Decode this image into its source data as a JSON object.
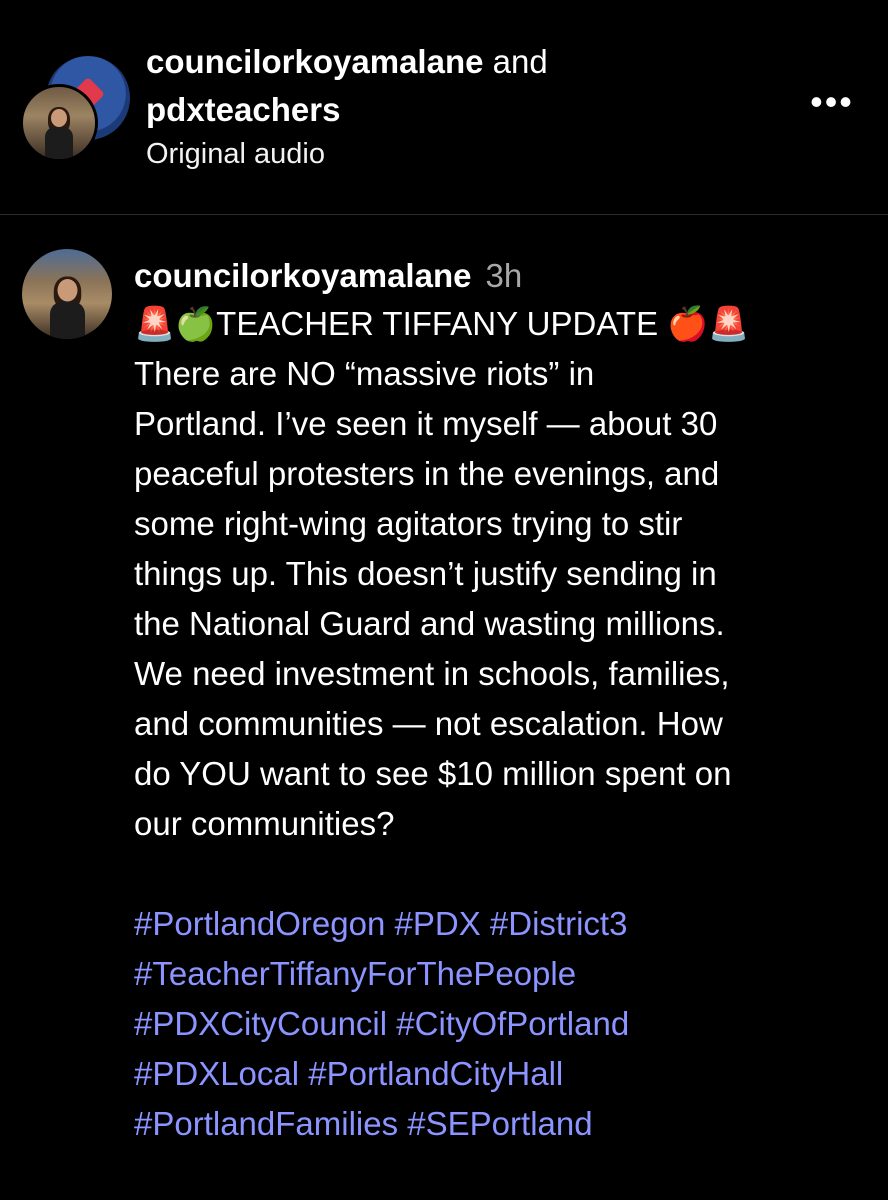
{
  "header": {
    "author1": "councilorkoyamalane",
    "joiner": "and",
    "author2": "pdxteachers",
    "audio": "Original audio",
    "more_icon": "more-horizontal-icon",
    "more_symbol": "•••"
  },
  "comment": {
    "username": "councilorkoyamalane",
    "time": "3h",
    "title": "🚨🍏TEACHER TIFFANY UPDATE 🍎🚨",
    "body": "There are NO “massive riots” in\nPortland. I’ve seen it myself — about 30\npeaceful protesters in the evenings, and\nsome right-wing agitators trying to stir\nthings up. This doesn’t justify sending in\nthe National Guard and wasting millions.\nWe need investment in schools, families,\nand communities — not escalation. How\ndo YOU want to see $10 million spent on\nour communities?",
    "hashtag_lines": [
      [
        "#PortlandOregon",
        "#PDX",
        "#District3"
      ],
      [
        "#TeacherTiffanyForThePeople"
      ],
      [
        "#PDXCityCouncil",
        "#CityOfPortland"
      ],
      [
        "#PDXLocal",
        "#PortlandCityHall"
      ],
      [
        "#PortlandFamilies",
        "#SEPortland"
      ]
    ]
  },
  "colors": {
    "background": "#000000",
    "text": "#ffffff",
    "muted": "#a8a8a8",
    "hashtag": "#8b94ff",
    "divider": "#2c2c2c"
  }
}
